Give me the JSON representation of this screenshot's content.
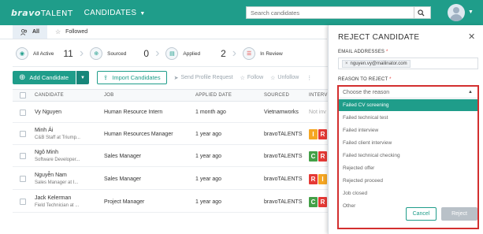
{
  "header": {
    "logo_brand": "bravo",
    "logo_suffix": "TALENT",
    "module": "CANDIDATES",
    "search_placeholder": "Search candidates"
  },
  "tabs": [
    {
      "label": "All",
      "active": true
    },
    {
      "label": "Followed",
      "active": false
    }
  ],
  "stats": [
    {
      "label": "All Active",
      "count": "11"
    },
    {
      "label": "Sourced",
      "count": "0"
    },
    {
      "label": "Applied",
      "count": "2"
    },
    {
      "label": "In Review",
      "count": ""
    }
  ],
  "toolbar": {
    "add_label": "Add Candidate",
    "import_label": "Import Candidates",
    "send_label": "Send Profile Request",
    "follow_label": "Follow",
    "unfollow_label": "Unfollow"
  },
  "table": {
    "headers": [
      "CANDIDATE",
      "JOB",
      "APPLIED DATE",
      "SOURCED",
      "INTERV"
    ],
    "rows": [
      {
        "name": "Vy Nguyen",
        "sub": "",
        "job": "Human Resource Intern",
        "date": "1 month ago",
        "source": "Vietnamworks",
        "interview": "Not inv",
        "chips": []
      },
      {
        "name": "Minh Ái",
        "sub": "C&B Staff at Triump...",
        "job": "Human Resources Manager",
        "date": "1 year ago",
        "source": "bravoTALENTS",
        "interview": "",
        "chips": [
          {
            "letter": "I",
            "color": "#f5a623"
          },
          {
            "letter": "R",
            "color": "#e53935"
          }
        ]
      },
      {
        "name": "Ngô Minh",
        "sub": "Software Developer...",
        "job": "Sales Manager",
        "date": "1 year ago",
        "source": "bravoTALENTS",
        "interview": "",
        "chips": [
          {
            "letter": "C",
            "color": "#43a047"
          },
          {
            "letter": "R",
            "color": "#e53935"
          }
        ]
      },
      {
        "name": "Nguyễn Nam",
        "sub": "Sales Manager at I...",
        "job": "Sales Manager",
        "date": "1 year ago",
        "source": "bravoTALENTS",
        "interview": "",
        "chips": [
          {
            "letter": "R",
            "color": "#e53935"
          },
          {
            "letter": "I",
            "color": "#f5a623"
          }
        ]
      },
      {
        "name": "Jack Kelerman",
        "sub": "Field Technician at ...",
        "job": "Project Manager",
        "date": "1 year ago",
        "source": "bravoTALENTS",
        "interview": "",
        "chips": [
          {
            "letter": "C",
            "color": "#43a047"
          },
          {
            "letter": "R",
            "color": "#e53935"
          }
        ]
      }
    ]
  },
  "panel": {
    "title": "REJECT CANDIDATE",
    "email_label": "EMAIL ADDRESSES",
    "email_value": "nguyen.vy@mailinator.com",
    "reason_label": "REASON TO REJECT",
    "reason_placeholder": "Choose the reason",
    "options": [
      "Failed CV screening",
      "Failed technical test",
      "Failed interview",
      "Failed client interview",
      "Failed technical checking",
      "Rejected offer",
      "Rejected proceed",
      "Job closed",
      "Other"
    ],
    "selected_option": "Failed CV screening",
    "cancel_label": "Cancel",
    "reject_label": "Reject"
  },
  "colors": {
    "brand": "#1f9d8a",
    "highlight_border": "#d32f2f"
  }
}
